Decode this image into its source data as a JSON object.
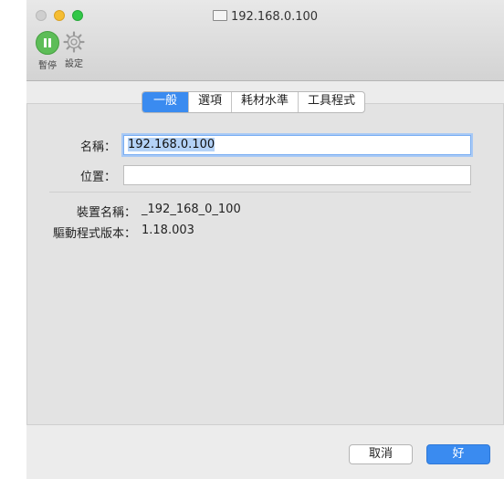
{
  "window": {
    "title": "192.168.0.100"
  },
  "toolbar": {
    "pause_label": "暫停",
    "settings_label": "設定"
  },
  "tabs": [
    {
      "label": "一般",
      "active": true
    },
    {
      "label": "選項",
      "active": false
    },
    {
      "label": "耗材水準",
      "active": false
    },
    {
      "label": "工具程式",
      "active": false
    }
  ],
  "form": {
    "name_label": "名稱：",
    "name_value": "192.168.0.100",
    "location_label": "位置：",
    "location_value": ""
  },
  "info": {
    "device_name_label": "裝置名稱：",
    "device_name_value": "_192_168_0_100",
    "driver_version_label": "驅動程式版本：",
    "driver_version_value": "1.18.003"
  },
  "buttons": {
    "cancel_label": "取消",
    "ok_label": "好"
  },
  "colors": {
    "accent": "#3a8bf0",
    "pause_green": "#5dbd58",
    "close": "#cfcfcf",
    "minimize": "#f5bd32",
    "zoom": "#32c748"
  }
}
